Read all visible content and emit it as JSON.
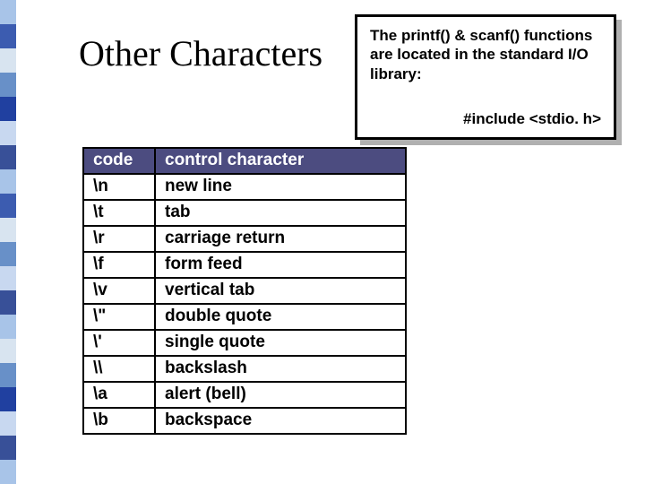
{
  "sidebar_colors": [
    "#a8c4e8",
    "#3c5cb0",
    "#d8e4f0",
    "#6890c8",
    "#2040a0",
    "#c8d8f0",
    "#385098",
    "#a8c4e8",
    "#3c5cb0",
    "#d8e4f0",
    "#6890c8",
    "#c8d8f0",
    "#385098",
    "#a8c4e8",
    "#d8e4f0",
    "#6890c8",
    "#2040a0",
    "#c8d8f0",
    "#385098",
    "#a8c4e8"
  ],
  "title": "Other Characters",
  "callout": {
    "line": "The printf() & scanf() functions are located in the standard I/O library:",
    "include": "#include <stdio. h>"
  },
  "table": {
    "headers": {
      "code": "code",
      "desc": "control character"
    },
    "rows": [
      {
        "code": "\\n",
        "desc": "new line"
      },
      {
        "code": "\\t",
        "desc": "tab"
      },
      {
        "code": "\\r",
        "desc": "carriage return"
      },
      {
        "code": "\\f",
        "desc": "form feed"
      },
      {
        "code": "\\v",
        "desc": "vertical tab"
      },
      {
        "code": "\\\"",
        "desc": "double quote"
      },
      {
        "code": "\\'",
        "desc": "single quote"
      },
      {
        "code": "\\\\",
        "desc": "backslash"
      },
      {
        "code": "\\a",
        "desc": "alert (bell)"
      },
      {
        "code": "\\b",
        "desc": "backspace"
      }
    ]
  }
}
